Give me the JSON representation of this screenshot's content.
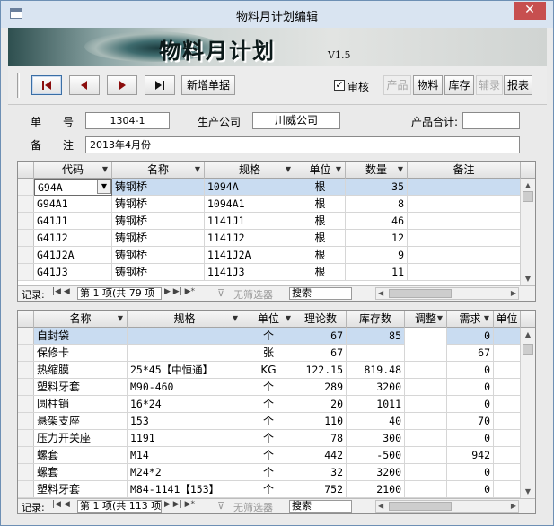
{
  "window": {
    "title": "物料月计划编辑",
    "close": "✕"
  },
  "banner": {
    "title": "物料月计划",
    "version": "V1.5"
  },
  "toolbar": {
    "new_label": "新增单据",
    "approve_label": "审核",
    "approve_checked": true,
    "approve_mark": "✓",
    "buttons": [
      {
        "label": "产品",
        "enabled": false
      },
      {
        "label": "物料",
        "enabled": true
      },
      {
        "label": "库存",
        "enabled": true
      },
      {
        "label": "辅录",
        "enabled": false
      },
      {
        "label": "报表",
        "enabled": true
      }
    ]
  },
  "form": {
    "no_label": "单　　号",
    "no_value": "1304-1",
    "company_label": "生产公司",
    "company_value": "川威公司",
    "total_label": "产品合计:",
    "total_value": "",
    "note_label": "备　　注",
    "note_value": "2013年4月份"
  },
  "grid1": {
    "headers": [
      "代码",
      "名称",
      "规格",
      "单位",
      "数量",
      "备注"
    ],
    "rows": [
      {
        "code": "G94A",
        "name": "铸钢桥",
        "spec": "1094A",
        "unit": "根",
        "qty": "35",
        "note": ""
      },
      {
        "code": "G94A1",
        "name": "铸钢桥",
        "spec": "1094A1",
        "unit": "根",
        "qty": "8",
        "note": ""
      },
      {
        "code": "G41J1",
        "name": "铸钢桥",
        "spec": "1141J1",
        "unit": "根",
        "qty": "46",
        "note": ""
      },
      {
        "code": "G41J2",
        "name": "铸钢桥",
        "spec": "1141J2",
        "unit": "根",
        "qty": "12",
        "note": ""
      },
      {
        "code": "G41J2A",
        "name": "铸钢桥",
        "spec": "1141J2A",
        "unit": "根",
        "qty": "9",
        "note": ""
      },
      {
        "code": "G41J3",
        "name": "铸钢桥",
        "spec": "1141J3",
        "unit": "根",
        "qty": "11",
        "note": ""
      }
    ],
    "nav": {
      "record_label": "记录:",
      "position": "第 1 项(共 79 项",
      "filter": "无筛选器",
      "search": "搜索"
    }
  },
  "grid2": {
    "headers": [
      "名称",
      "规格",
      "单位",
      "理论数",
      "库存数",
      "调整",
      "需求",
      "单位"
    ],
    "rows": [
      {
        "name": "自封袋",
        "spec": "",
        "unit": "个",
        "theory": "67",
        "stock": "85",
        "adjust": "",
        "demand": "0"
      },
      {
        "name": "保修卡",
        "spec": "",
        "unit": "张",
        "theory": "67",
        "stock": "",
        "adjust": "",
        "demand": "67"
      },
      {
        "name": "热缩膜",
        "spec": "25*45【中恒通】",
        "unit": "KG",
        "theory": "122.15",
        "stock": "819.48",
        "adjust": "",
        "demand": "0"
      },
      {
        "name": "塑料牙套",
        "spec": "M90-460",
        "unit": "个",
        "theory": "289",
        "stock": "3200",
        "adjust": "",
        "demand": "0"
      },
      {
        "name": "圆柱销",
        "spec": "16*24",
        "unit": "个",
        "theory": "20",
        "stock": "1011",
        "adjust": "",
        "demand": "0"
      },
      {
        "name": "悬架支座",
        "spec": "153",
        "unit": "个",
        "theory": "110",
        "stock": "40",
        "adjust": "",
        "demand": "70"
      },
      {
        "name": "压力开关座",
        "spec": "1191",
        "unit": "个",
        "theory": "78",
        "stock": "300",
        "adjust": "",
        "demand": "0"
      },
      {
        "name": "螺套",
        "spec": "M14",
        "unit": "个",
        "theory": "442",
        "stock": "-500",
        "adjust": "",
        "demand": "942"
      },
      {
        "name": "螺套",
        "spec": "M24*2",
        "unit": "个",
        "theory": "32",
        "stock": "3200",
        "adjust": "",
        "demand": "0"
      },
      {
        "name": "塑料牙套",
        "spec": "M84-1141【153】",
        "unit": "个",
        "theory": "752",
        "stock": "2100",
        "adjust": "",
        "demand": "0"
      }
    ],
    "nav": {
      "record_label": "记录:",
      "position": "第 1 项(共 113 项",
      "filter": "无筛选器",
      "search": "搜索"
    }
  }
}
